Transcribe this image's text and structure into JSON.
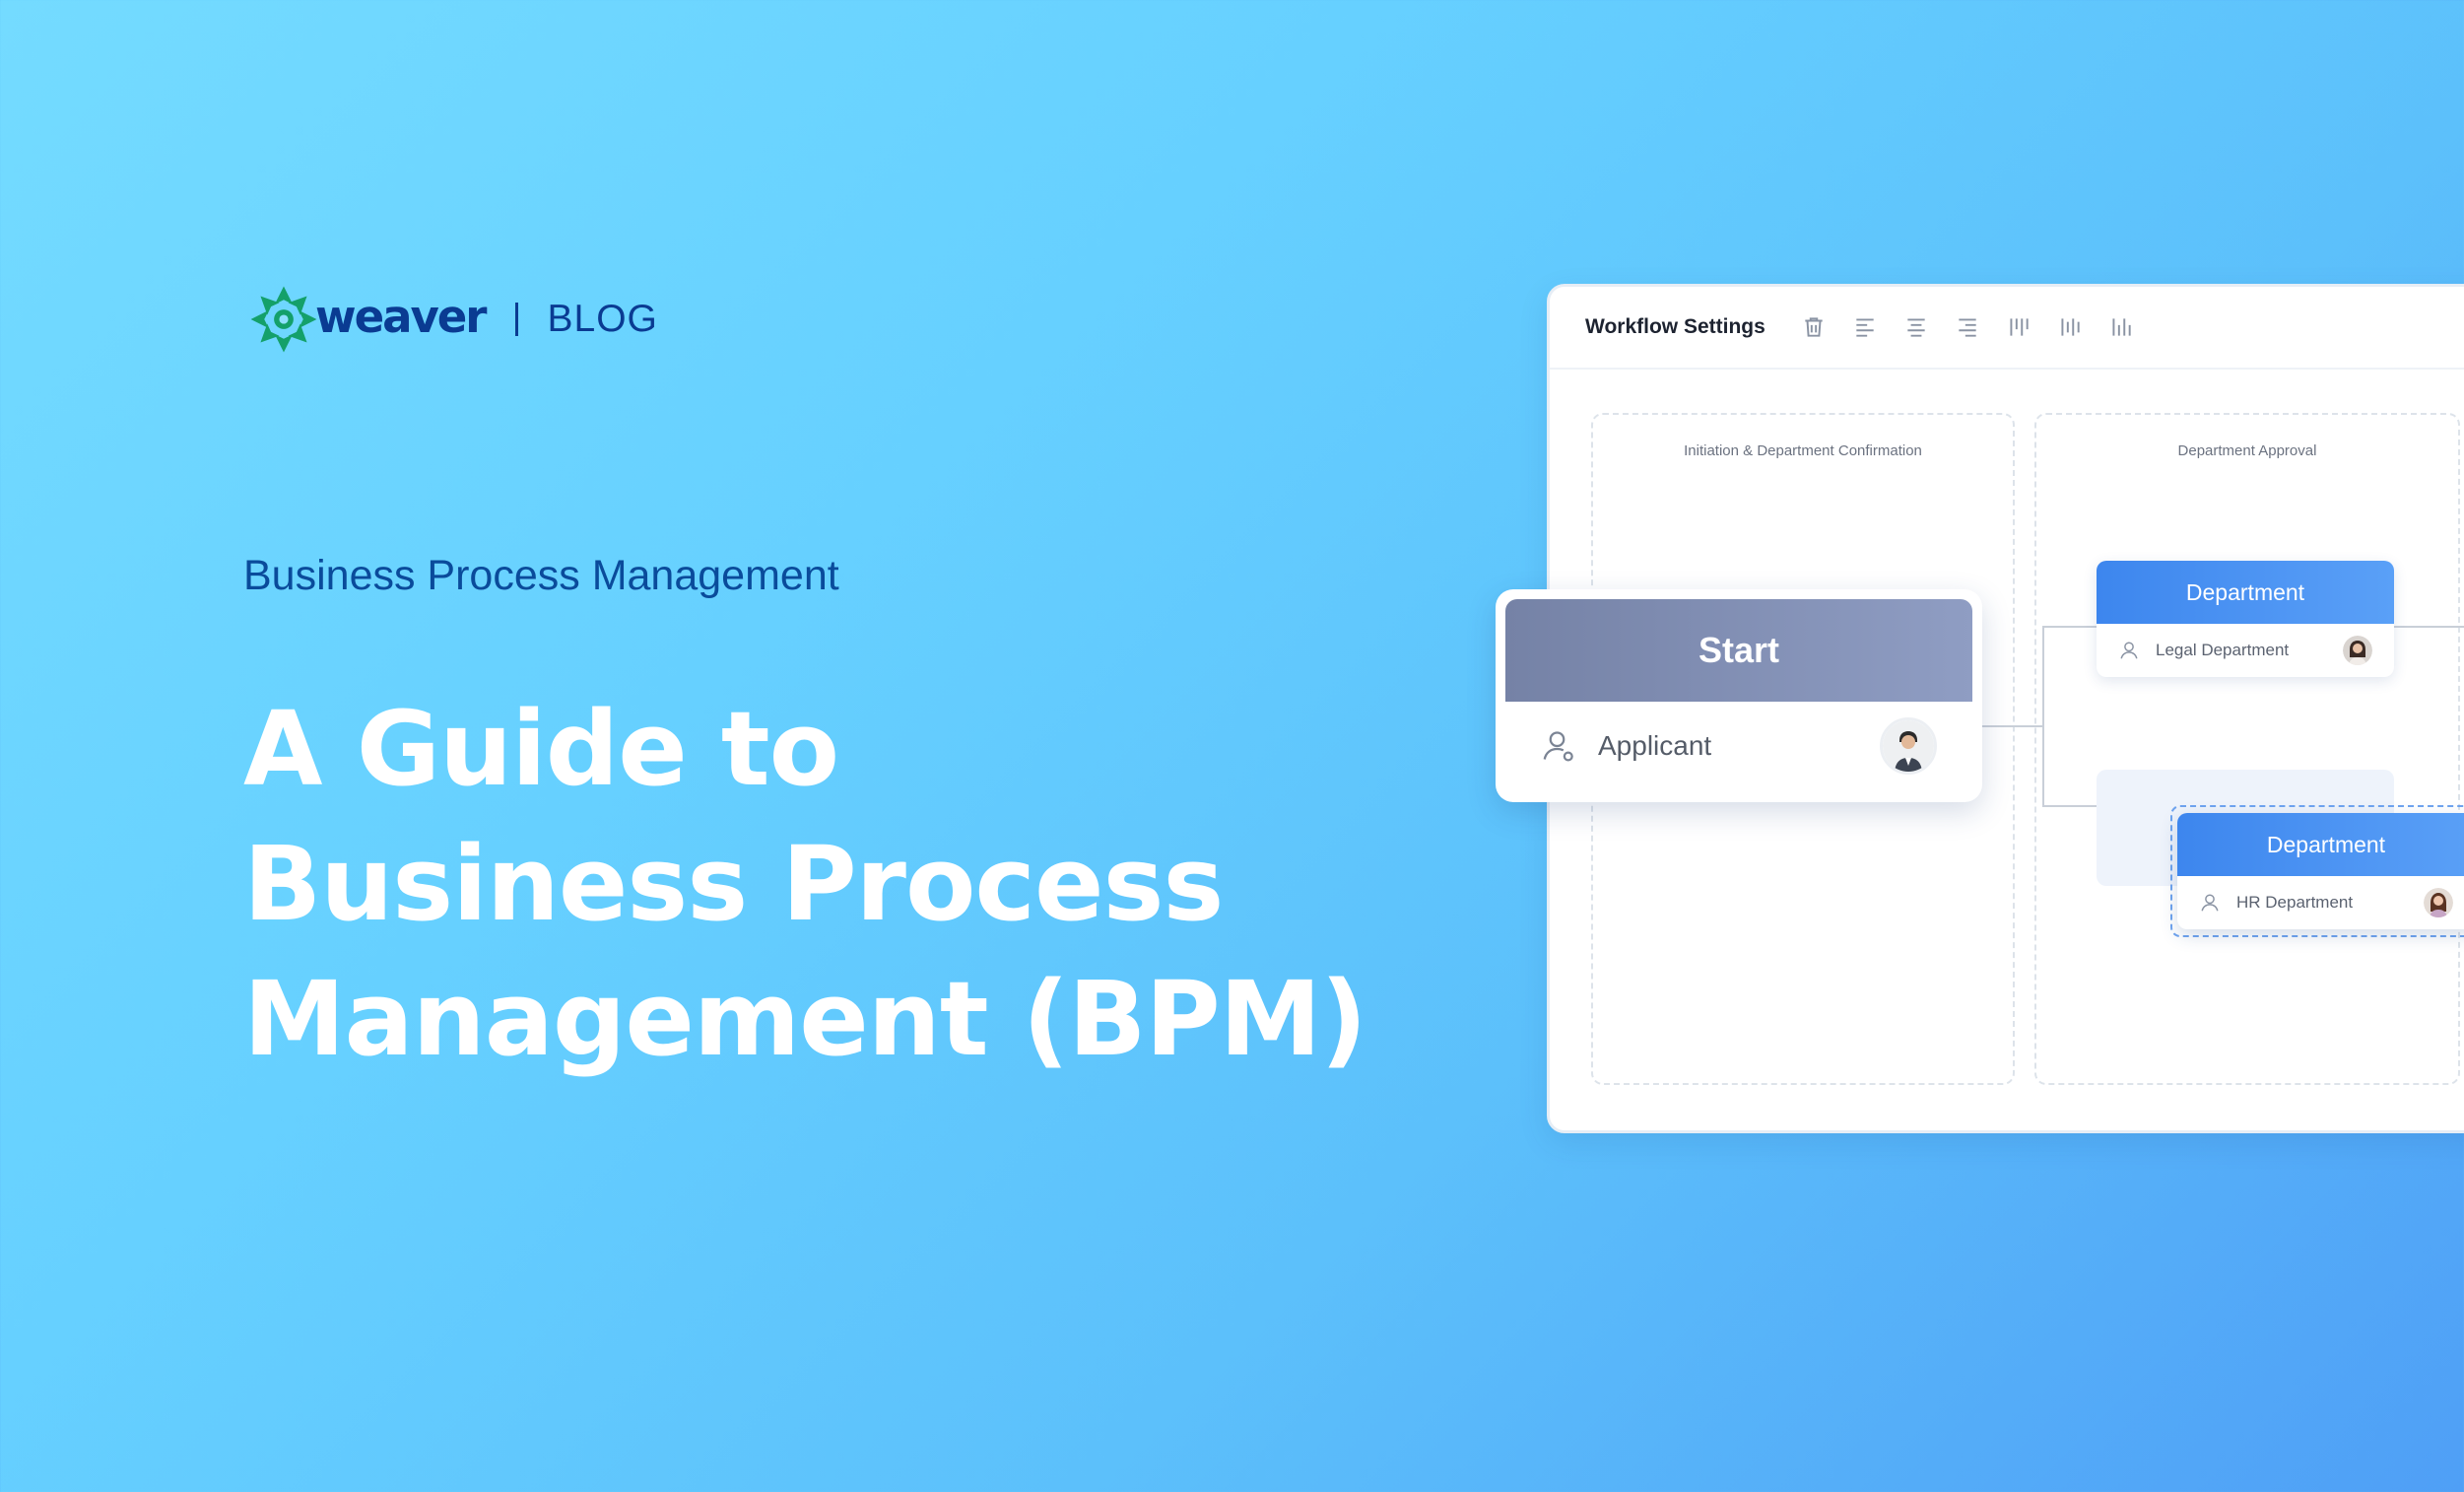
{
  "brand": {
    "logo_word": "weaver",
    "section": "BLOG",
    "logo_color": "#14a06a",
    "text_color": "#0a3b92"
  },
  "hero": {
    "category": "Business Process Management",
    "title_lines": [
      "A Guide to",
      "Business Process",
      "Management (BPM)"
    ]
  },
  "workflow_panel": {
    "title": "Workflow Settings",
    "toolbar_icons": [
      "delete-icon",
      "align-left-icon",
      "align-center-icon",
      "align-right-icon",
      "align-top-icon",
      "align-middle-icon",
      "align-bottom-icon"
    ],
    "lanes": [
      {
        "label": "Initiation & Department Confirmation"
      },
      {
        "label": "Department Approval"
      }
    ],
    "start_node": {
      "title": "Start",
      "role": "Applicant"
    },
    "department_nodes": [
      {
        "title": "Department",
        "assignee": "Legal Department"
      },
      {
        "title": "Department",
        "assignee": "HR Department"
      }
    ],
    "accent_color": "#3d86ee",
    "start_color": "#7582a6"
  }
}
